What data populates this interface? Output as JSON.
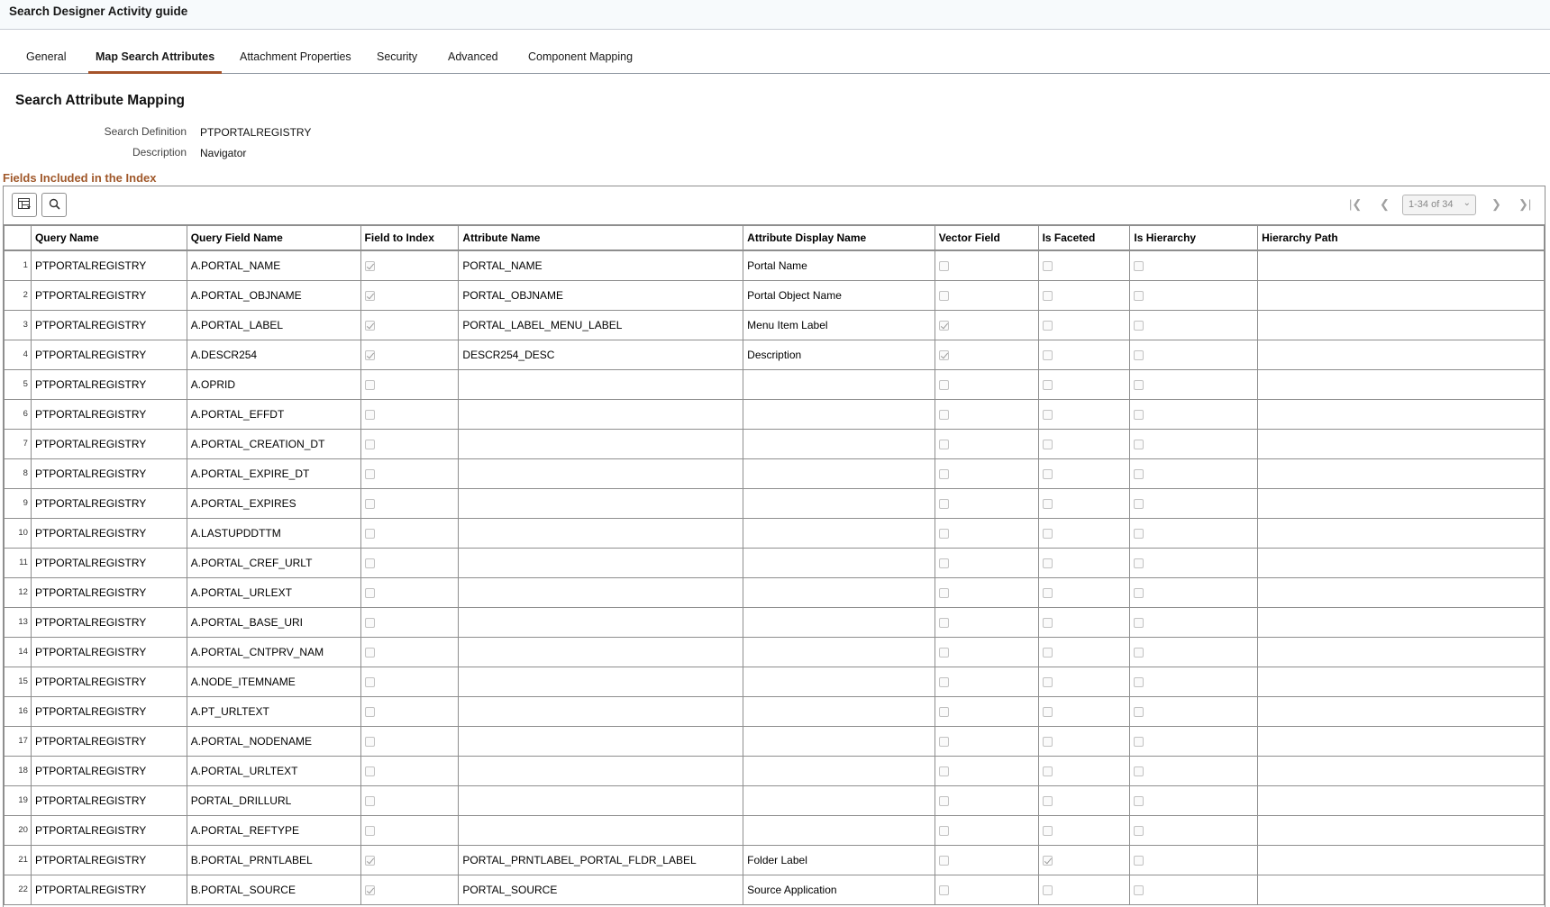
{
  "window": {
    "title": "Search Designer Activity guide"
  },
  "tabs": [
    {
      "label": "General",
      "active": false
    },
    {
      "label": "Map Search Attributes",
      "active": true
    },
    {
      "label": "Attachment Properties",
      "active": false
    },
    {
      "label": "Security",
      "active": false
    },
    {
      "label": "Advanced",
      "active": false
    },
    {
      "label": "Component Mapping",
      "active": false
    }
  ],
  "page": {
    "title": "Search Attribute Mapping",
    "search_definition_label": "Search Definition",
    "search_definition_value": "PTPORTALREGISTRY",
    "description_label": "Description",
    "description_value": "Navigator"
  },
  "grid": {
    "title": "Fields Included in the Index",
    "pager_text": "1-34 of 34",
    "icons": {
      "personalize": "grid-personalize-icon",
      "find": "search-icon",
      "first": "first-page-icon",
      "prev": "previous-page-icon",
      "next": "next-page-icon",
      "last": "last-page-icon"
    },
    "columns": [
      "",
      "Query Name",
      "Query Field Name",
      "Field to Index",
      "Attribute Name",
      "Attribute Display Name",
      "Vector Field",
      "Is Faceted",
      "Is Hierarchy",
      "Hierarchy Path"
    ],
    "rows": [
      {
        "num": "1",
        "query_name": "PTPORTALREGISTRY",
        "query_field": "A.PORTAL_NAME",
        "field_to_index": true,
        "attribute_name": "PORTAL_NAME",
        "display_name": "Portal Name",
        "vector": false,
        "faceted": false,
        "hierarchy": false,
        "path": ""
      },
      {
        "num": "2",
        "query_name": "PTPORTALREGISTRY",
        "query_field": "A.PORTAL_OBJNAME",
        "field_to_index": true,
        "attribute_name": "PORTAL_OBJNAME",
        "display_name": "Portal Object Name",
        "vector": false,
        "faceted": false,
        "hierarchy": false,
        "path": ""
      },
      {
        "num": "3",
        "query_name": "PTPORTALREGISTRY",
        "query_field": "A.PORTAL_LABEL",
        "field_to_index": true,
        "attribute_name": "PORTAL_LABEL_MENU_LABEL",
        "display_name": "Menu Item Label",
        "vector": true,
        "faceted": false,
        "hierarchy": false,
        "path": ""
      },
      {
        "num": "4",
        "query_name": "PTPORTALREGISTRY",
        "query_field": "A.DESCR254",
        "field_to_index": true,
        "attribute_name": "DESCR254_DESC",
        "display_name": "Description",
        "vector": true,
        "faceted": false,
        "hierarchy": false,
        "path": ""
      },
      {
        "num": "5",
        "query_name": "PTPORTALREGISTRY",
        "query_field": "A.OPRID",
        "field_to_index": false,
        "attribute_name": "",
        "display_name": "",
        "vector": false,
        "faceted": false,
        "hierarchy": false,
        "path": ""
      },
      {
        "num": "6",
        "query_name": "PTPORTALREGISTRY",
        "query_field": "A.PORTAL_EFFDT",
        "field_to_index": false,
        "attribute_name": "",
        "display_name": "",
        "vector": false,
        "faceted": false,
        "hierarchy": false,
        "path": ""
      },
      {
        "num": "7",
        "query_name": "PTPORTALREGISTRY",
        "query_field": "A.PORTAL_CREATION_DT",
        "field_to_index": false,
        "attribute_name": "",
        "display_name": "",
        "vector": false,
        "faceted": false,
        "hierarchy": false,
        "path": ""
      },
      {
        "num": "8",
        "query_name": "PTPORTALREGISTRY",
        "query_field": "A.PORTAL_EXPIRE_DT",
        "field_to_index": false,
        "attribute_name": "",
        "display_name": "",
        "vector": false,
        "faceted": false,
        "hierarchy": false,
        "path": ""
      },
      {
        "num": "9",
        "query_name": "PTPORTALREGISTRY",
        "query_field": "A.PORTAL_EXPIRES",
        "field_to_index": false,
        "attribute_name": "",
        "display_name": "",
        "vector": false,
        "faceted": false,
        "hierarchy": false,
        "path": ""
      },
      {
        "num": "10",
        "query_name": "PTPORTALREGISTRY",
        "query_field": "A.LASTUPDDTTM",
        "field_to_index": false,
        "attribute_name": "",
        "display_name": "",
        "vector": false,
        "faceted": false,
        "hierarchy": false,
        "path": ""
      },
      {
        "num": "11",
        "query_name": "PTPORTALREGISTRY",
        "query_field": "A.PORTAL_CREF_URLT",
        "field_to_index": false,
        "attribute_name": "",
        "display_name": "",
        "vector": false,
        "faceted": false,
        "hierarchy": false,
        "path": ""
      },
      {
        "num": "12",
        "query_name": "PTPORTALREGISTRY",
        "query_field": "A.PORTAL_URLEXT",
        "field_to_index": false,
        "attribute_name": "",
        "display_name": "",
        "vector": false,
        "faceted": false,
        "hierarchy": false,
        "path": ""
      },
      {
        "num": "13",
        "query_name": "PTPORTALREGISTRY",
        "query_field": "A.PORTAL_BASE_URI",
        "field_to_index": false,
        "attribute_name": "",
        "display_name": "",
        "vector": false,
        "faceted": false,
        "hierarchy": false,
        "path": ""
      },
      {
        "num": "14",
        "query_name": "PTPORTALREGISTRY",
        "query_field": "A.PORTAL_CNTPRV_NAM",
        "field_to_index": false,
        "attribute_name": "",
        "display_name": "",
        "vector": false,
        "faceted": false,
        "hierarchy": false,
        "path": ""
      },
      {
        "num": "15",
        "query_name": "PTPORTALREGISTRY",
        "query_field": "A.NODE_ITEMNAME",
        "field_to_index": false,
        "attribute_name": "",
        "display_name": "",
        "vector": false,
        "faceted": false,
        "hierarchy": false,
        "path": ""
      },
      {
        "num": "16",
        "query_name": "PTPORTALREGISTRY",
        "query_field": "A.PT_URLTEXT",
        "field_to_index": false,
        "attribute_name": "",
        "display_name": "",
        "vector": false,
        "faceted": false,
        "hierarchy": false,
        "path": ""
      },
      {
        "num": "17",
        "query_name": "PTPORTALREGISTRY",
        "query_field": "A.PORTAL_NODENAME",
        "field_to_index": false,
        "attribute_name": "",
        "display_name": "",
        "vector": false,
        "faceted": false,
        "hierarchy": false,
        "path": ""
      },
      {
        "num": "18",
        "query_name": "PTPORTALREGISTRY",
        "query_field": "A.PORTAL_URLTEXT",
        "field_to_index": false,
        "attribute_name": "",
        "display_name": "",
        "vector": false,
        "faceted": false,
        "hierarchy": false,
        "path": ""
      },
      {
        "num": "19",
        "query_name": "PTPORTALREGISTRY",
        "query_field": "PORTAL_DRILLURL",
        "field_to_index": false,
        "attribute_name": "",
        "display_name": "",
        "vector": false,
        "faceted": false,
        "hierarchy": false,
        "path": ""
      },
      {
        "num": "20",
        "query_name": "PTPORTALREGISTRY",
        "query_field": "A.PORTAL_REFTYPE",
        "field_to_index": false,
        "attribute_name": "",
        "display_name": "",
        "vector": false,
        "faceted": false,
        "hierarchy": false,
        "path": ""
      },
      {
        "num": "21",
        "query_name": "PTPORTALREGISTRY",
        "query_field": "B.PORTAL_PRNTLABEL",
        "field_to_index": true,
        "attribute_name": "PORTAL_PRNTLABEL_PORTAL_FLDR_LABEL",
        "display_name": "Folder Label",
        "vector": false,
        "faceted": true,
        "hierarchy": false,
        "path": ""
      },
      {
        "num": "22",
        "query_name": "PTPORTALREGISTRY",
        "query_field": "B.PORTAL_SOURCE",
        "field_to_index": true,
        "attribute_name": "PORTAL_SOURCE",
        "display_name": "Source Application",
        "vector": false,
        "faceted": false,
        "hierarchy": false,
        "path": ""
      }
    ]
  }
}
